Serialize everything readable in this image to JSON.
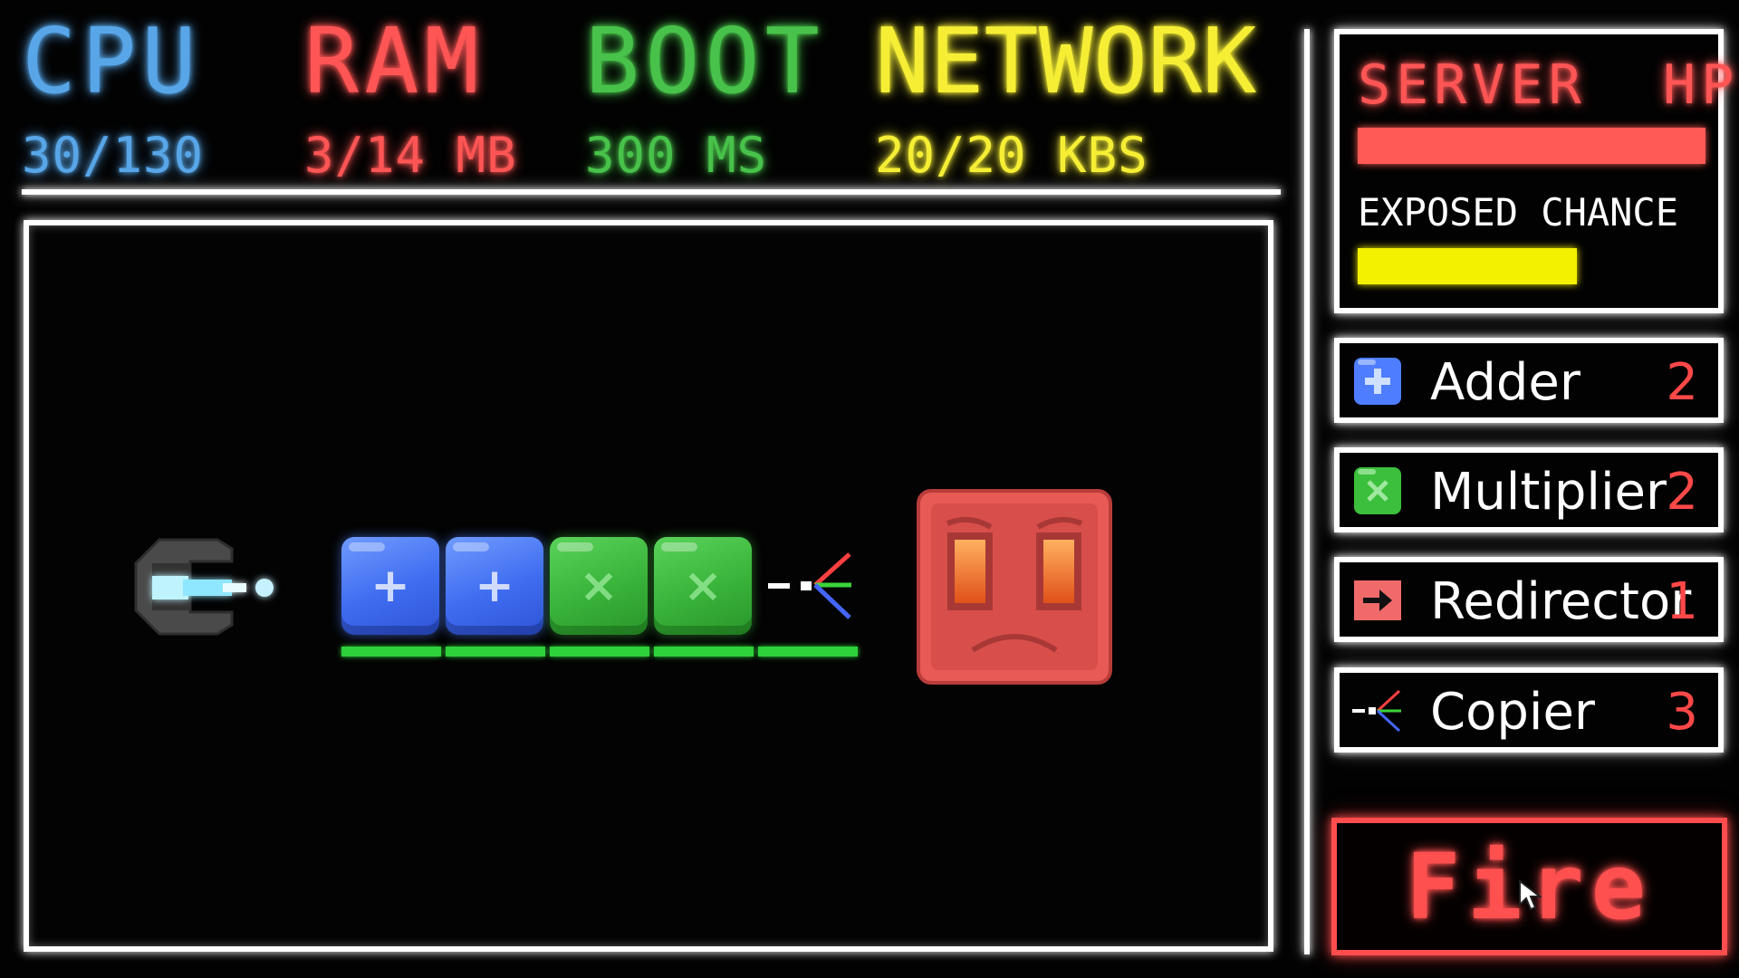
{
  "stats": {
    "cpu": {
      "title": "CPU",
      "value": "30/130",
      "color": "#58a6e8"
    },
    "ram": {
      "title": "RAM",
      "value": "3/14 MB",
      "color": "#ff5555"
    },
    "boot": {
      "title": "BOOT",
      "value": "300 MS",
      "color": "#48c24a"
    },
    "network": {
      "title": "NETWORK",
      "value": "20/20 KBS",
      "color": "#f5ee35"
    }
  },
  "status_panel": {
    "server_hp_label": "SERVER  HP",
    "server_hp_fraction": 1.0,
    "exposed_chance_label": "EXPOSED CHANCE",
    "exposed_chance_fraction": 0.63
  },
  "inventory": [
    {
      "name": "Adder",
      "count": "2",
      "icon": "adder-block-icon"
    },
    {
      "name": "Multiplier",
      "count": "2",
      "icon": "multiplier-block-icon"
    },
    {
      "name": "Redirector",
      "count": "1",
      "icon": "redirector-arrow-icon"
    },
    {
      "name": "Copier",
      "count": "3",
      "icon": "copier-splitter-icon"
    }
  ],
  "board": {
    "chain": [
      "adder",
      "adder",
      "multiplier",
      "multiplier",
      "copier"
    ],
    "enemy": "angry-server-face"
  },
  "fire_button": {
    "label": "Fire"
  },
  "colors": {
    "panel_border": "#ffffff",
    "accent_red": "#ff4d4d",
    "hp_bar": "#ff5a55",
    "exposed_bar": "#f3f000",
    "slot_bar": "#2ed13a"
  }
}
